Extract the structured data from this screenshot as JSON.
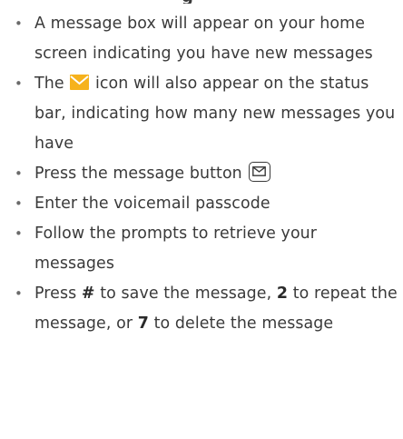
{
  "heading_fragment": "g",
  "steps": [
    {
      "text": "A message box will appear on your home screen indicating you have new messages"
    },
    {
      "before": "The",
      "icon": "envelope-icon",
      "after": "icon will also appear on the status bar, indicating how many new messages you have"
    },
    {
      "before": "Press the message button",
      "icon": "message-button-icon"
    },
    {
      "text": "Enter the voicemail passcode"
    },
    {
      "text": "Follow the prompts to retrieve your messages"
    },
    {
      "p1": "Press",
      "k1": "#",
      "p2": "to save the message,",
      "k2": "2",
      "p3": "to repeat the message, or",
      "k3": "7",
      "p4": "to delete the message"
    }
  ],
  "colors": {
    "text": "#3a3a3a",
    "envelope": "#f6b21c"
  }
}
